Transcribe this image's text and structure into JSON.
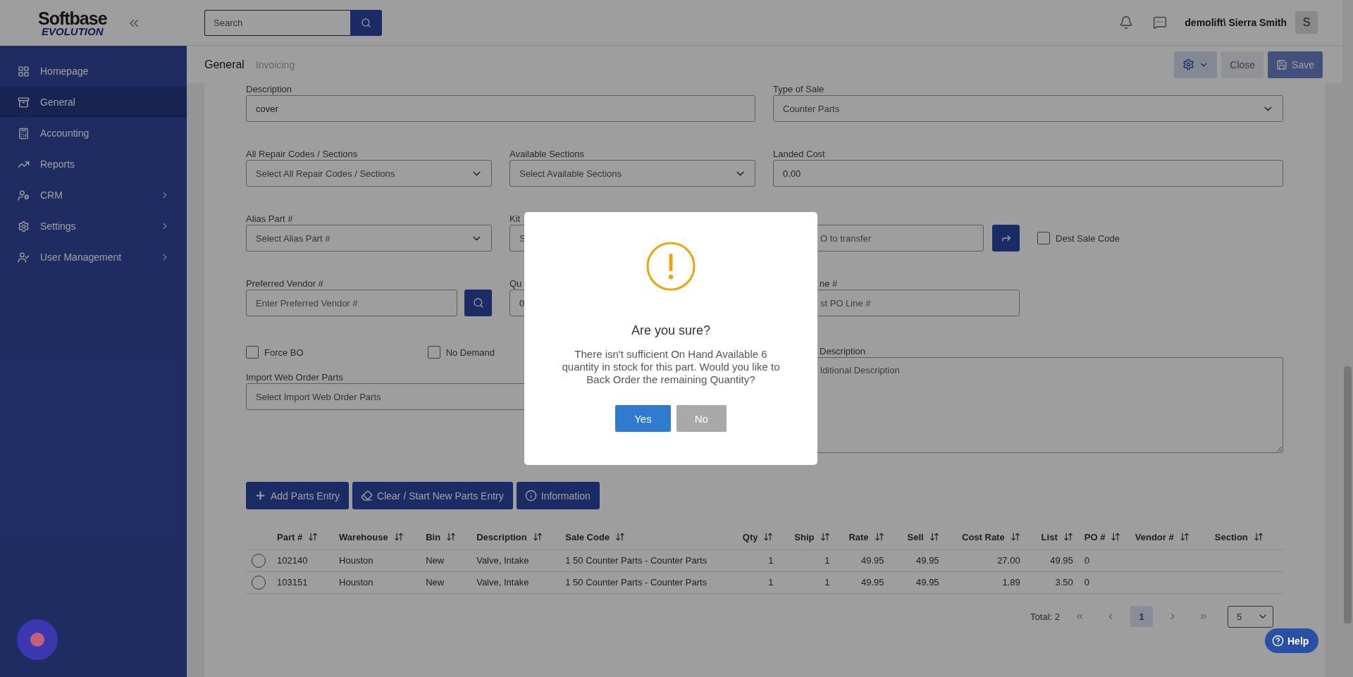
{
  "logo": {
    "top": "Softbase",
    "bottom": "EVOLUTION"
  },
  "sidebar": {
    "items": [
      {
        "label": "Homepage",
        "kind": "grid",
        "selected": false,
        "has_children": false
      },
      {
        "label": "General",
        "kind": "archive",
        "selected": true,
        "has_children": false
      },
      {
        "label": "Accounting",
        "kind": "calculator",
        "selected": false,
        "has_children": false
      },
      {
        "label": "Reports",
        "kind": "chart",
        "selected": false,
        "has_children": false
      },
      {
        "label": "CRM",
        "kind": "user-gear",
        "selected": false,
        "has_children": true
      },
      {
        "label": "Settings",
        "kind": "gear",
        "selected": false,
        "has_children": true
      },
      {
        "label": "User Management",
        "kind": "user-check",
        "selected": false,
        "has_children": true
      }
    ]
  },
  "top_bar": {
    "search": {
      "placeholder": "Search"
    },
    "user": "demolift\\ Sierra Smith",
    "avatar": "S"
  },
  "sub_header": {
    "tabs": [
      {
        "label": "General",
        "selected": true
      },
      {
        "label": "Invoicing",
        "selected": false
      }
    ],
    "buttons": [
      {
        "kind": "settings"
      },
      {
        "kind": "close",
        "label": "Close"
      },
      {
        "kind": "save",
        "label": "Save"
      }
    ]
  },
  "form": {
    "description": {
      "label": "Description",
      "value": "cover"
    },
    "type_of_sale": {
      "label": "Type of Sale",
      "value": "Counter Parts"
    },
    "repair_codes": {
      "label": "All Repair Codes / Sections",
      "placeholder": "Select All Repair Codes / Sections"
    },
    "available_sections": {
      "label": "Available Sections",
      "placeholder": "Select Available Sections"
    },
    "landed_cost": {
      "label": "Landed Cost",
      "value": "0.00"
    },
    "alias_part": {
      "label": "Alias Part #",
      "placeholder": "Select Alias Part #"
    },
    "kit": {
      "label": "Kit",
      "placeholder": "S"
    },
    "transfer": {
      "placeholder": "O to transfer"
    },
    "dest_sale_code": {
      "label": "Dest Sale Code",
      "checked": false
    },
    "preferred_vendor": {
      "label": "Preferred Vendor #",
      "placeholder": "Enter Preferred Vendor #"
    },
    "quantity": {
      "label": "Qu",
      "value": "0"
    },
    "po_line": {
      "label": "ne #",
      "placeholder": "st PO Line #"
    },
    "force_bo": {
      "label": "Force BO",
      "checked": false
    },
    "no_demand": {
      "label": "No Demand",
      "checked": false
    },
    "additional_description": {
      "label": "Description",
      "placeholder": "lditional Description"
    },
    "import_web_order": {
      "label": "Import Web Order Parts",
      "placeholder": "Select Import Web Order Parts"
    }
  },
  "actions": [
    {
      "label": "Add Parts Entry",
      "kind": "add"
    },
    {
      "label": "Clear / Start New Parts Entry",
      "kind": "clear"
    },
    {
      "label": "Information",
      "kind": "info"
    }
  ],
  "table": {
    "columns": [
      {
        "label": "Part #",
        "kind": "text"
      },
      {
        "label": "Warehouse",
        "kind": "text"
      },
      {
        "label": "Bin",
        "kind": "text"
      },
      {
        "label": "Description",
        "kind": "text"
      },
      {
        "label": "Sale Code",
        "kind": "text"
      },
      {
        "label": "Qty",
        "kind": "number"
      },
      {
        "label": "Ship",
        "kind": "number"
      },
      {
        "label": "Rate",
        "kind": "number"
      },
      {
        "label": "Sell",
        "kind": "number"
      },
      {
        "label": "Cost Rate",
        "kind": "number"
      },
      {
        "label": "List",
        "kind": "number"
      },
      {
        "label": "PO #",
        "kind": "text"
      },
      {
        "label": "Vendor #",
        "kind": "text"
      },
      {
        "label": "Section",
        "kind": "text"
      }
    ],
    "rows": [
      {
        "selected": false,
        "cells": [
          "102140",
          "Houston",
          "New",
          "Valve, Intake",
          "1 50 Counter Parts - Counter Parts",
          "1",
          "1",
          "49.95",
          "49.95",
          "27.00",
          "49.95",
          "0",
          "",
          ""
        ]
      },
      {
        "selected": false,
        "cells": [
          "103151",
          "Houston",
          "New",
          "Valve, Intake",
          "1 50 Counter Parts - Counter Parts",
          "1",
          "1",
          "49.95",
          "49.95",
          "1.89",
          "3.50",
          "0",
          "",
          ""
        ]
      }
    ]
  },
  "pagination": {
    "total": "Total: 2",
    "pages": [
      {
        "label": "1",
        "selected": true
      }
    ],
    "page_size": "5"
  },
  "help": {
    "label": "Help"
  },
  "dialog": {
    "title": "Are you sure?",
    "message": "There isn't sufficient On Hand Available 6 quantity in stock for this part. Would you like to Back Order the remaining Quantity?",
    "buttons": [
      {
        "label": "Yes",
        "kind": "confirm"
      },
      {
        "label": "No",
        "kind": "cancel"
      }
    ]
  }
}
